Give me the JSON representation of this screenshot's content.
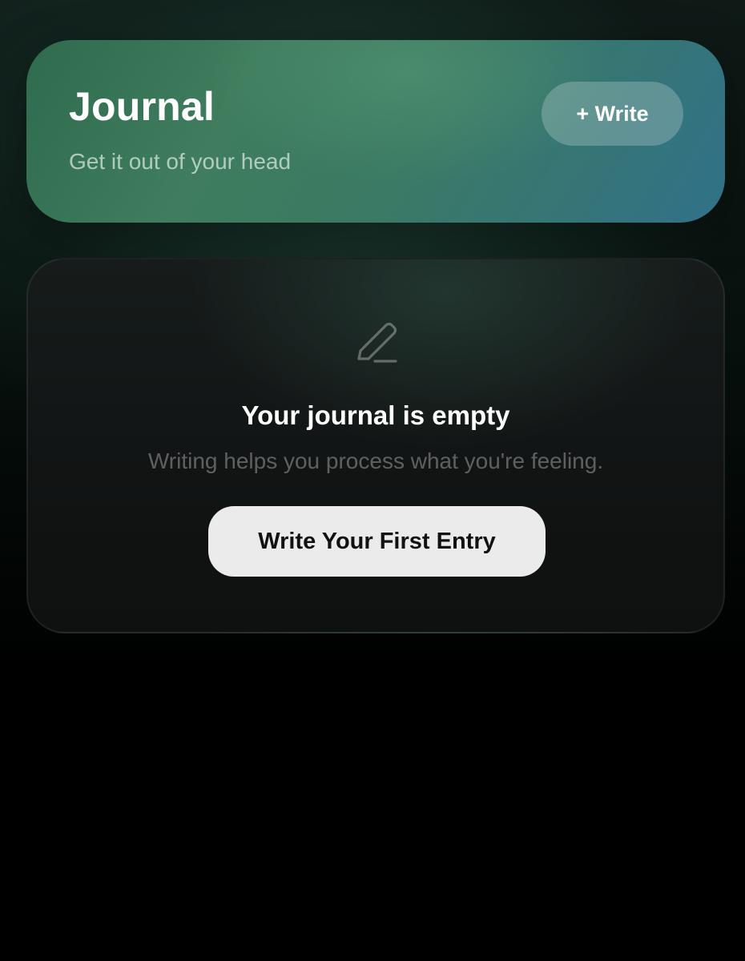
{
  "header": {
    "title": "Journal",
    "subtitle": "Get it out of your head",
    "write_button_label": "+ Write"
  },
  "empty_state": {
    "icon": "pencil-icon",
    "title": "Your journal is empty",
    "subtitle": "Writing helps you process what you're feeling.",
    "cta_label": "Write Your First Entry"
  },
  "colors": {
    "header_gradient_start": "#2f6b4e",
    "header_gradient_end": "#31718a",
    "background": "#000000",
    "cta_background": "#ebebeb"
  }
}
